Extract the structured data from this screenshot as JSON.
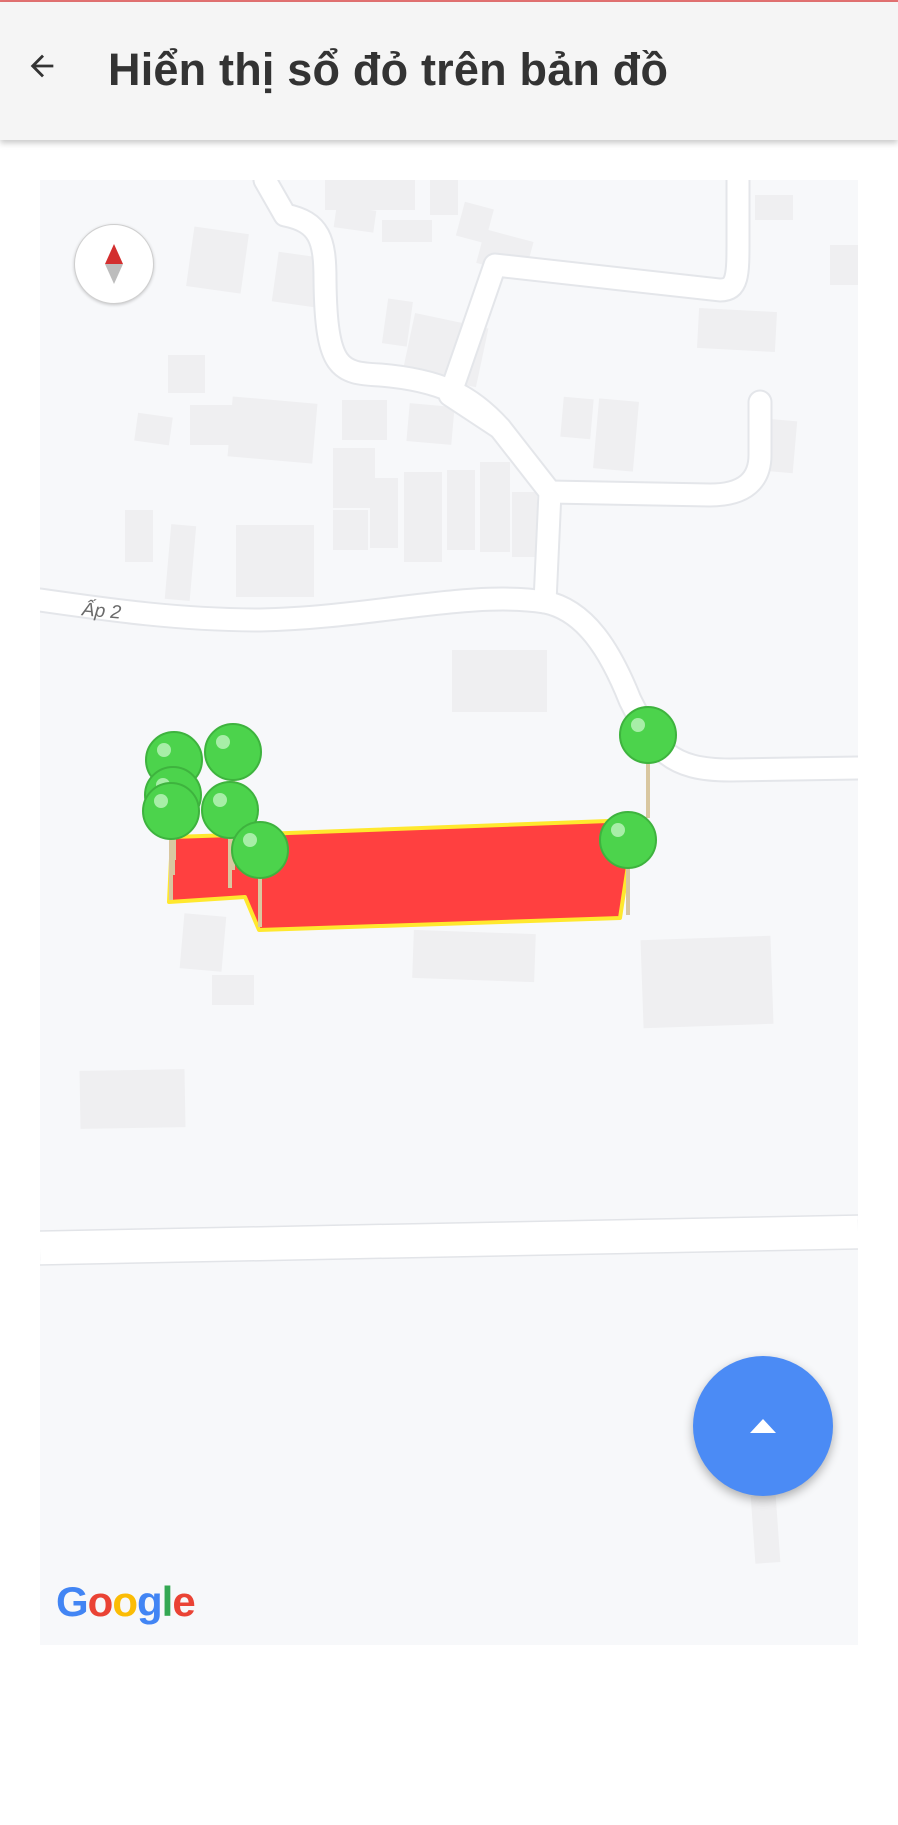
{
  "appbar": {
    "title": "Hiển thị sổ đỏ trên bản đồ",
    "back_icon": "arrow-left-icon"
  },
  "map": {
    "road_label": "Ấp 2",
    "compass_icon": "compass-icon",
    "fab_icon": "chevron-up-icon",
    "logo_letters": [
      "G",
      "o",
      "o",
      "g",
      "l",
      "e"
    ],
    "logo_colors": [
      "#4285F4",
      "#EA4335",
      "#FBBC05",
      "#4285F4",
      "#34A853",
      "#EA4335"
    ],
    "parcel_fill": "#ff4040",
    "parcel_stroke": "#ffe82e",
    "pin_color": "#4cd34c",
    "pin_count": 8
  }
}
